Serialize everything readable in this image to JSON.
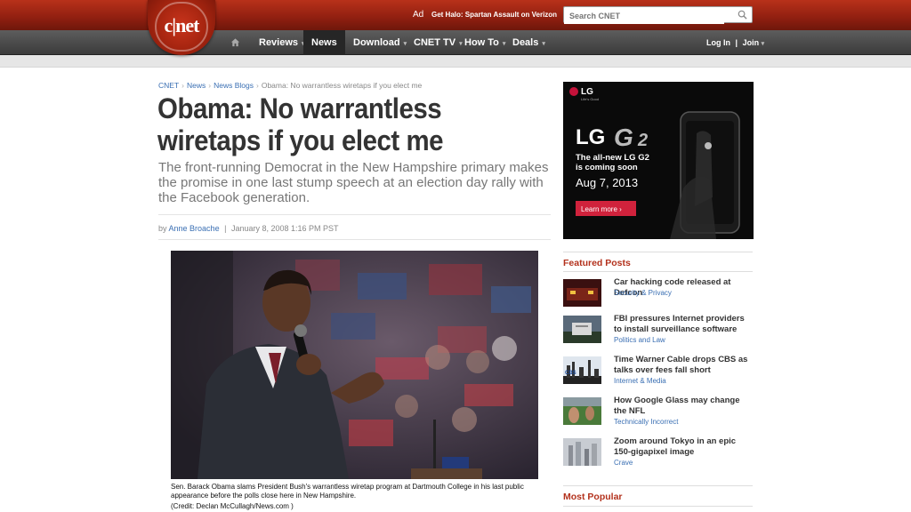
{
  "brand": {
    "logo_text": "c|net"
  },
  "top": {
    "ad_label": "Ad",
    "ad_text": "Get Halo: Spartan Assault on Verizon",
    "search_placeholder": "Search CNET"
  },
  "nav": {
    "items": [
      {
        "label": "Reviews",
        "caret": "▾"
      },
      {
        "label": "News",
        "caret": ""
      },
      {
        "label": "Download",
        "caret": "▾"
      },
      {
        "label": "CNET TV",
        "caret": "▾"
      },
      {
        "label": "How To",
        "caret": "▾"
      },
      {
        "label": "Deals",
        "caret": "▾"
      }
    ],
    "login": "Log In",
    "join": "Join",
    "separator": "|"
  },
  "breadcrumb": [
    "CNET",
    "News",
    "News Blogs",
    "Obama: No warrantless wiretaps if you elect me"
  ],
  "article": {
    "headline": "Obama: No warrantless wiretaps if you elect me",
    "dek": "The front-running Democrat in the New Hampshire primary makes the promise in one last stump speech at an election day rally with the Facebook generation.",
    "by": "by",
    "author": "Anne Broache",
    "date": "January 8, 2008 1:16 PM PST",
    "caption": "Sen. Barack Obama slams President Bush's warrantless wiretap program at Dartmouth College in his last public appearance before the polls close here in New Hampshire.",
    "credit": "(Credit: Declan McCullagh/News.com )"
  },
  "ad": {
    "brand": "LG",
    "tagline": "Life's Good",
    "product": "LG G2",
    "line1": "The all-new LG G2",
    "line2": "is coming soon",
    "date": "Aug 7, 2013",
    "cta": "Learn more"
  },
  "featured": {
    "title": "Featured Posts",
    "posts": [
      {
        "title": "Car hacking code released at Defcon",
        "category": "Security & Privacy"
      },
      {
        "title": "FBI pressures Internet providers to install surveillance software",
        "category": "Politics and Law"
      },
      {
        "title": "Time Warner Cable drops CBS as talks over fees fall short",
        "category": "Internet & Media"
      },
      {
        "title": "How Google Glass may change the NFL",
        "category": "Technically Incorrect"
      },
      {
        "title": "Zoom around Tokyo in an epic 150-gigapixel image",
        "category": "Crave"
      }
    ]
  },
  "most_popular": {
    "title": "Most Popular"
  }
}
